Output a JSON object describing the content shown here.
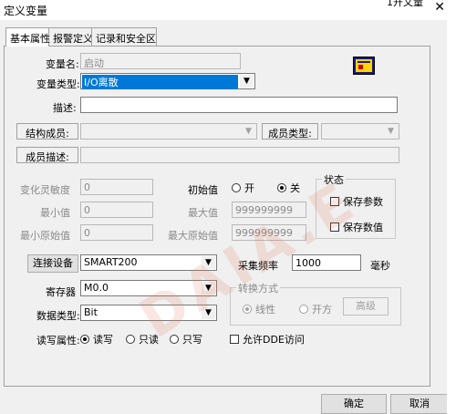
{
  "window": {
    "title": "定义变量",
    "right_fragment": "1开文量",
    "close_glyph": "✕"
  },
  "tabs": [
    {
      "label": "基本属性",
      "active": true
    },
    {
      "label": "报警定义",
      "active": false
    },
    {
      "label": "记录和安全区",
      "active": false
    }
  ],
  "form": {
    "var_name_label": "变量名:",
    "var_name_value": "启动",
    "var_type_label": "变量类型:",
    "var_type_value": "I/O离散",
    "desc_label": "描述:",
    "desc_value": "",
    "struct_member_label": "结构成员:",
    "member_type_label": "成员类型:",
    "member_desc_label": "成员描述:",
    "sensitivity_label": "变化灵敏度",
    "sensitivity_value": "0",
    "min_label": "最小值",
    "min_value": "0",
    "raw_min_label": "最小原始值",
    "raw_min_value": "0",
    "initial_label": "初始值",
    "initial_on": "开",
    "initial_off": "关",
    "initial_selected": "关",
    "max_label": "最大值",
    "max_value": "999999999",
    "raw_max_label": "最大原始值",
    "raw_max_value": "999999999",
    "state_group_title": "状态",
    "save_params": "保存参数",
    "save_values": "保存数值",
    "connect_button": "连接设备",
    "device_value": "SMART200",
    "sample_rate_label": "采集频率",
    "sample_rate_value": "1000",
    "sample_rate_unit": "毫秒",
    "register_label": "寄存器",
    "register_value": "M0.0",
    "convert_group_title": "转换方式",
    "linear": "线性",
    "sqrt": "开方",
    "advanced_button": "高级",
    "data_type_label": "数据类型:",
    "data_type_value": "Bit",
    "rw_label": "读写属性:",
    "rw_readwrite": "读写",
    "rw_readonly": "只读",
    "rw_writeonly": "只写",
    "rw_selected": "读写",
    "dde_label": "允许DDE访问"
  },
  "footer": {
    "ok": "确定",
    "cancel": "取消"
  },
  "watermark": "DAIA.E",
  "icons": {
    "dropdown": "▼"
  }
}
